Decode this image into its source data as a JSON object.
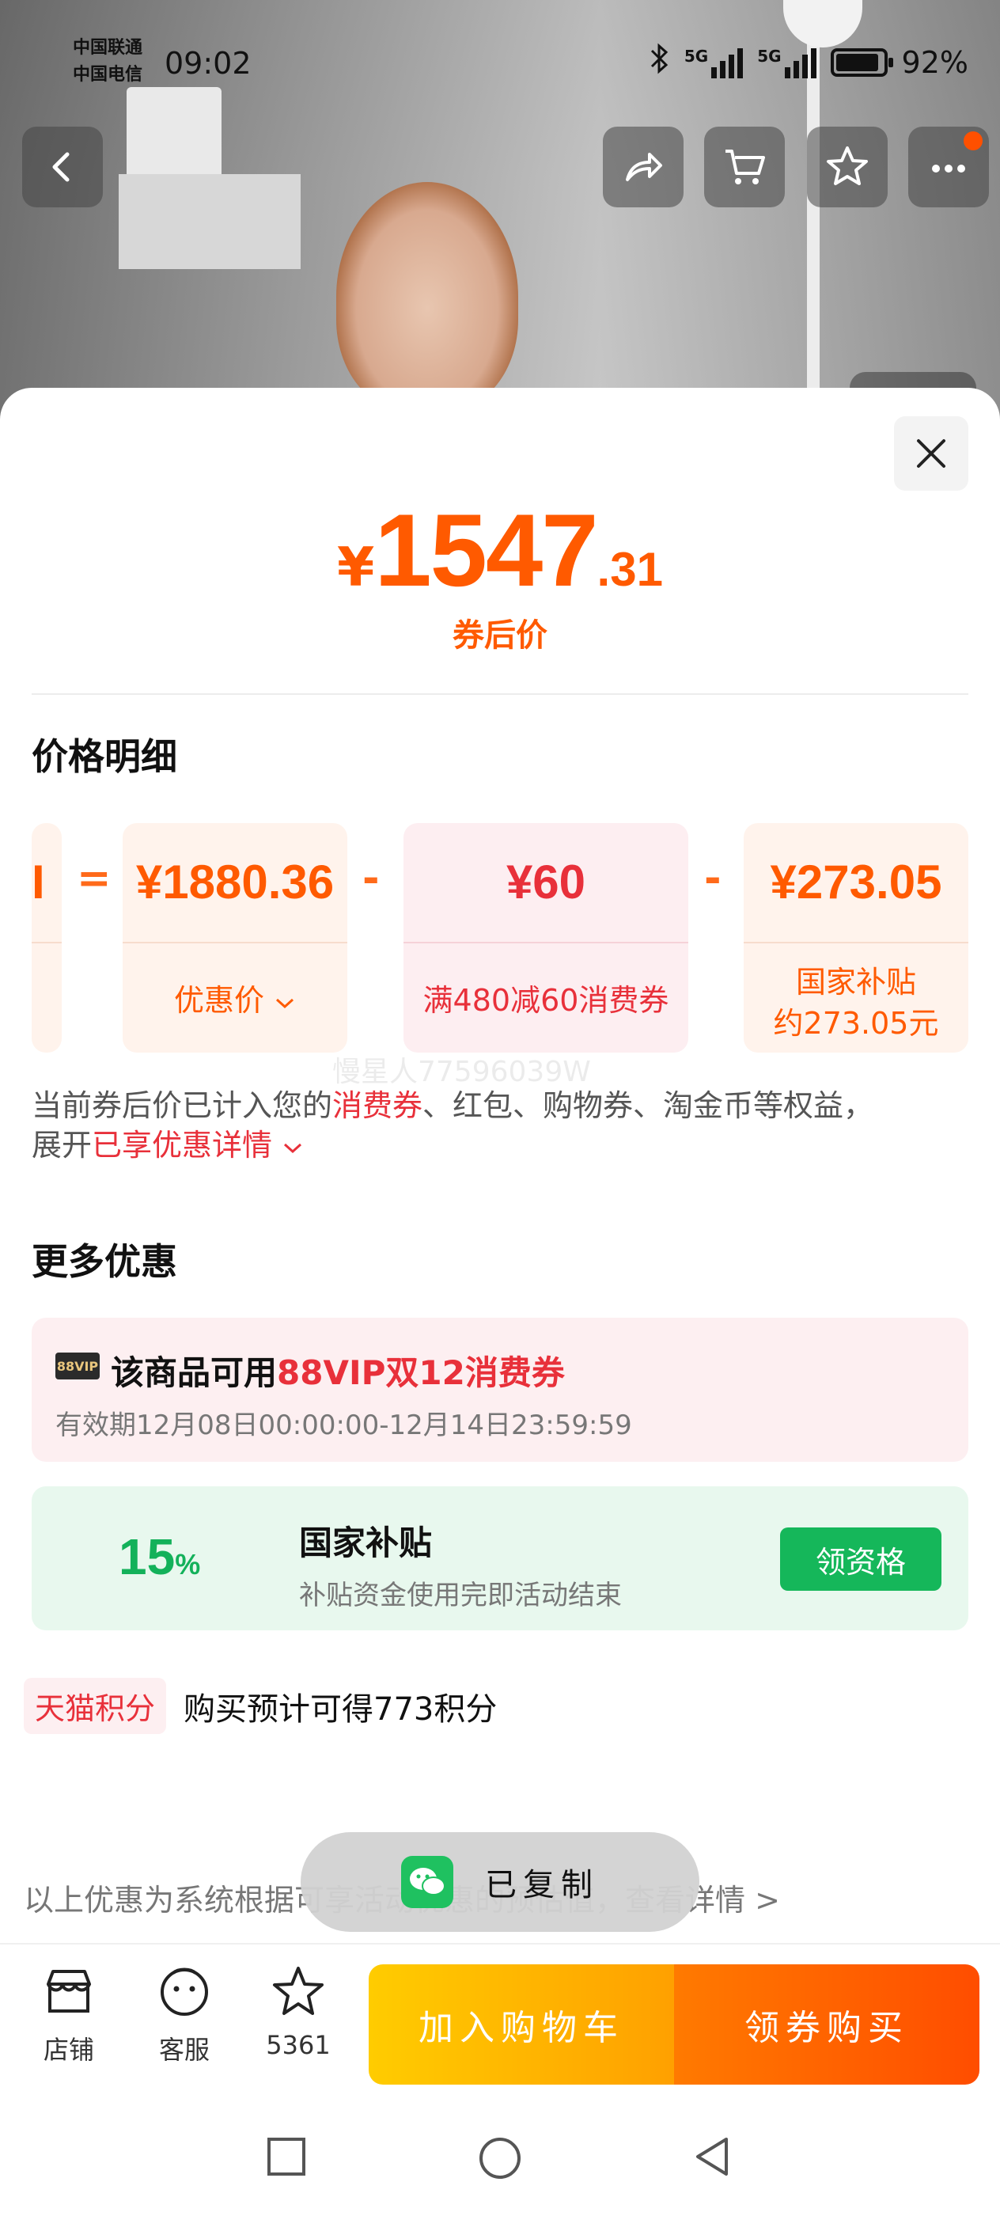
{
  "status_bar": {
    "carrier_1": "中国联通",
    "carrier_2": "中国电信",
    "time": "09:02",
    "signal_1_label": "5G",
    "signal_2_label": "5G",
    "battery_percent": "92%",
    "battery_level": 0.92
  },
  "top_nav": {
    "icons": [
      "back-icon",
      "share-icon",
      "cart-icon",
      "star-icon",
      "more-icon"
    ]
  },
  "price": {
    "currency": "¥",
    "integer": "1547",
    "decimal": ".31",
    "label": "券后价"
  },
  "price_detail": {
    "title": "价格明细",
    "equals": "=",
    "minus": "-",
    "items": [
      {
        "value": "¥1880.36",
        "label": "优惠价"
      },
      {
        "value": "¥60",
        "label": "满480减60消费券"
      },
      {
        "value": "¥273.05",
        "label_line1": "国家补贴",
        "label_line2": "约273.05元"
      }
    ],
    "partial_left": "I",
    "watermark": "慢星人77596039W",
    "desc_prefix": "当前券后价已计入您的",
    "desc_highlight": "消费券",
    "desc_middle": "、红包、购物券、淘金币等权益，",
    "desc_line2_prefix": "展开",
    "desc_line2_link": "已享优惠详情"
  },
  "more_offers": {
    "title": "更多优惠",
    "vip": {
      "badge": "88VIP",
      "title_prefix": "该商品可用",
      "title_highlight": "88VIP双12消费券",
      "validity": "有效期12月08日00:00:00-12月14日23:59:59"
    },
    "subsidy": {
      "percent": "15",
      "percent_unit": "%",
      "title": "国家补贴",
      "desc": "补贴资金使用完即活动结束",
      "button": "领资格"
    },
    "points": {
      "tag": "天猫积分",
      "text": "购买预计可得773积分"
    }
  },
  "disclaimer": "以上优惠为系统根据可享活动优惠的预估值，查看详情 >",
  "toast": {
    "text": "已复制"
  },
  "bottom_bar": {
    "shop": "店铺",
    "service": "客服",
    "favorites": "5361",
    "add_to_cart": "加入购物车",
    "buy": "领券购买"
  },
  "colors": {
    "accent": "#ff5a00",
    "red": "#e8303a",
    "green": "#15b75a"
  }
}
